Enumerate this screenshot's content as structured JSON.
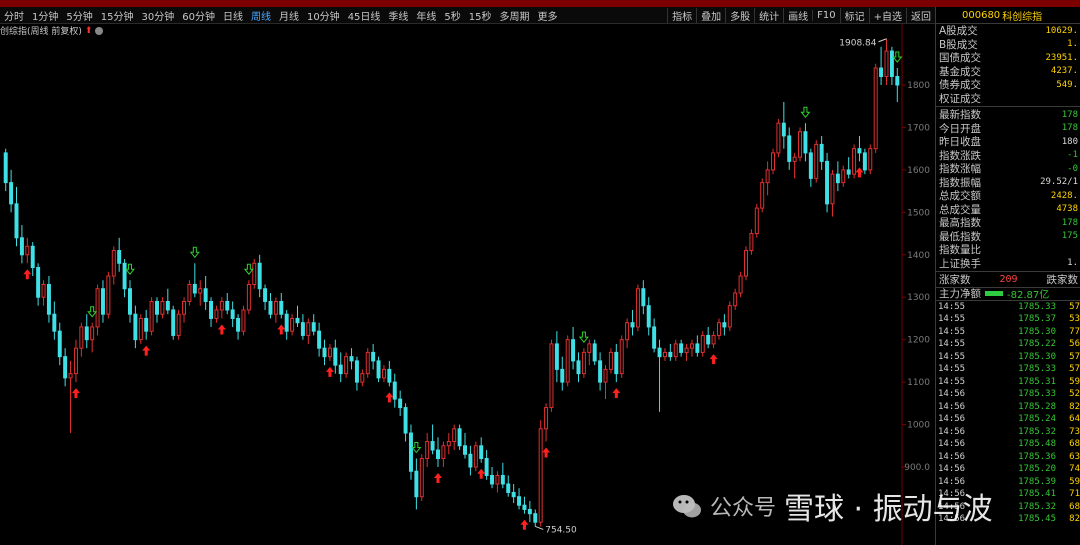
{
  "toolbar": {
    "periods": [
      "分时",
      "1分钟",
      "5分钟",
      "15分钟",
      "30分钟",
      "60分钟",
      "日线",
      "周线",
      "月线",
      "10分钟",
      "45日线",
      "季线",
      "年线",
      "5秒",
      "15秒",
      "多周期",
      "更多"
    ],
    "active_period": "周线",
    "tools": [
      "指标",
      "叠加",
      "多股",
      "统计",
      "画线",
      "F10",
      "标记",
      "+自选",
      "返回"
    ]
  },
  "chart_title": {
    "name": "创综指(周线 前复权)"
  },
  "y_axis": {
    "ticks": [
      "1800",
      "1700",
      "1600",
      "1500",
      "1400",
      "1300",
      "1200",
      "1100",
      "1000",
      "900.0"
    ]
  },
  "annotations": {
    "high_label": "1908.84",
    "low_label": "754.50"
  },
  "chart_data": {
    "type": "candlestick",
    "title": "创综指(周线 前复权)",
    "y_range": [
      754.5,
      1908.84
    ],
    "y_ticks": [
      900,
      1000,
      1100,
      1200,
      1300,
      1400,
      1500,
      1600,
      1700,
      1800
    ],
    "annotations": [
      {
        "label": "1908.84",
        "type": "max"
      },
      {
        "label": "754.50",
        "type": "min"
      }
    ],
    "ohlc": [
      [
        1640,
        1650,
        1550,
        1570
      ],
      [
        1570,
        1600,
        1500,
        1520
      ],
      [
        1520,
        1560,
        1420,
        1440
      ],
      [
        1440,
        1470,
        1380,
        1400
      ],
      [
        1400,
        1440,
        1380,
        1420
      ],
      [
        1420,
        1430,
        1350,
        1370
      ],
      [
        1370,
        1380,
        1280,
        1300
      ],
      [
        1300,
        1340,
        1280,
        1330
      ],
      [
        1330,
        1350,
        1240,
        1260
      ],
      [
        1260,
        1290,
        1200,
        1220
      ],
      [
        1220,
        1240,
        1140,
        1160
      ],
      [
        1160,
        1180,
        1090,
        1110
      ],
      [
        1110,
        1150,
        980,
        1120
      ],
      [
        1120,
        1200,
        1100,
        1180
      ],
      [
        1180,
        1240,
        1160,
        1230
      ],
      [
        1230,
        1260,
        1180,
        1200
      ],
      [
        1200,
        1240,
        1170,
        1230
      ],
      [
        1230,
        1330,
        1210,
        1320
      ],
      [
        1320,
        1340,
        1240,
        1260
      ],
      [
        1260,
        1360,
        1250,
        1350
      ],
      [
        1350,
        1420,
        1330,
        1410
      ],
      [
        1410,
        1440,
        1360,
        1380
      ],
      [
        1380,
        1390,
        1300,
        1320
      ],
      [
        1320,
        1340,
        1240,
        1260
      ],
      [
        1260,
        1280,
        1180,
        1200
      ],
      [
        1200,
        1260,
        1190,
        1250
      ],
      [
        1250,
        1270,
        1200,
        1220
      ],
      [
        1220,
        1300,
        1210,
        1290
      ],
      [
        1290,
        1300,
        1240,
        1260
      ],
      [
        1260,
        1300,
        1250,
        1290
      ],
      [
        1290,
        1320,
        1260,
        1270
      ],
      [
        1270,
        1280,
        1200,
        1210
      ],
      [
        1210,
        1270,
        1200,
        1260
      ],
      [
        1260,
        1300,
        1240,
        1290
      ],
      [
        1290,
        1340,
        1280,
        1330
      ],
      [
        1330,
        1380,
        1300,
        1310
      ],
      [
        1310,
        1340,
        1280,
        1320
      ],
      [
        1320,
        1350,
        1270,
        1290
      ],
      [
        1290,
        1300,
        1230,
        1250
      ],
      [
        1250,
        1280,
        1240,
        1270
      ],
      [
        1270,
        1300,
        1250,
        1290
      ],
      [
        1290,
        1310,
        1260,
        1270
      ],
      [
        1270,
        1290,
        1230,
        1250
      ],
      [
        1250,
        1260,
        1200,
        1220
      ],
      [
        1220,
        1280,
        1210,
        1270
      ],
      [
        1270,
        1340,
        1260,
        1330
      ],
      [
        1330,
        1390,
        1320,
        1380
      ],
      [
        1380,
        1400,
        1300,
        1320
      ],
      [
        1320,
        1330,
        1270,
        1290
      ],
      [
        1290,
        1310,
        1250,
        1260
      ],
      [
        1260,
        1300,
        1240,
        1290
      ],
      [
        1290,
        1310,
        1250,
        1260
      ],
      [
        1260,
        1270,
        1200,
        1220
      ],
      [
        1220,
        1260,
        1210,
        1250
      ],
      [
        1250,
        1280,
        1230,
        1240
      ],
      [
        1240,
        1260,
        1200,
        1210
      ],
      [
        1210,
        1250,
        1190,
        1240
      ],
      [
        1240,
        1260,
        1210,
        1220
      ],
      [
        1220,
        1240,
        1160,
        1180
      ],
      [
        1180,
        1200,
        1140,
        1160
      ],
      [
        1160,
        1190,
        1150,
        1180
      ],
      [
        1180,
        1200,
        1120,
        1140
      ],
      [
        1140,
        1170,
        1100,
        1120
      ],
      [
        1120,
        1170,
        1110,
        1160
      ],
      [
        1160,
        1180,
        1130,
        1150
      ],
      [
        1150,
        1160,
        1080,
        1100
      ],
      [
        1100,
        1130,
        1090,
        1120
      ],
      [
        1120,
        1180,
        1110,
        1170
      ],
      [
        1170,
        1190,
        1130,
        1150
      ],
      [
        1150,
        1160,
        1100,
        1110
      ],
      [
        1110,
        1140,
        1100,
        1130
      ],
      [
        1130,
        1150,
        1090,
        1100
      ],
      [
        1100,
        1120,
        1040,
        1060
      ],
      [
        1060,
        1080,
        1020,
        1040
      ],
      [
        1040,
        1050,
        960,
        980
      ],
      [
        980,
        1000,
        870,
        890
      ],
      [
        890,
        920,
        800,
        830
      ],
      [
        830,
        930,
        820,
        920
      ],
      [
        920,
        980,
        900,
        960
      ],
      [
        960,
        1000,
        930,
        940
      ],
      [
        940,
        970,
        900,
        920
      ],
      [
        920,
        960,
        900,
        950
      ],
      [
        950,
        980,
        930,
        960
      ],
      [
        960,
        1000,
        940,
        990
      ],
      [
        990,
        1000,
        940,
        950
      ],
      [
        950,
        980,
        920,
        930
      ],
      [
        930,
        950,
        880,
        900
      ],
      [
        900,
        960,
        890,
        950
      ],
      [
        950,
        970,
        910,
        920
      ],
      [
        920,
        940,
        870,
        880
      ],
      [
        880,
        900,
        850,
        860
      ],
      [
        860,
        890,
        840,
        880
      ],
      [
        880,
        910,
        850,
        860
      ],
      [
        860,
        880,
        830,
        840
      ],
      [
        840,
        860,
        815,
        830
      ],
      [
        830,
        850,
        800,
        810
      ],
      [
        810,
        830,
        790,
        800
      ],
      [
        800,
        820,
        770,
        790
      ],
      [
        790,
        800,
        760,
        770
      ],
      [
        770,
        1010,
        760,
        990
      ],
      [
        990,
        1050,
        960,
        1040
      ],
      [
        1040,
        1200,
        1030,
        1190
      ],
      [
        1190,
        1220,
        1100,
        1130
      ],
      [
        1130,
        1160,
        1080,
        1100
      ],
      [
        1100,
        1210,
        1090,
        1200
      ],
      [
        1200,
        1230,
        1130,
        1150
      ],
      [
        1150,
        1170,
        1100,
        1120
      ],
      [
        1120,
        1180,
        1110,
        1170
      ],
      [
        1170,
        1200,
        1140,
        1190
      ],
      [
        1190,
        1200,
        1140,
        1150
      ],
      [
        1150,
        1170,
        1080,
        1100
      ],
      [
        1100,
        1140,
        1060,
        1130
      ],
      [
        1130,
        1180,
        1120,
        1170
      ],
      [
        1170,
        1190,
        1100,
        1120
      ],
      [
        1120,
        1210,
        1110,
        1200
      ],
      [
        1200,
        1250,
        1180,
        1240
      ],
      [
        1240,
        1270,
        1210,
        1230
      ],
      [
        1230,
        1330,
        1220,
        1320
      ],
      [
        1320,
        1340,
        1260,
        1280
      ],
      [
        1280,
        1300,
        1210,
        1230
      ],
      [
        1230,
        1250,
        1170,
        1180
      ],
      [
        1180,
        1200,
        1030,
        1160
      ],
      [
        1160,
        1180,
        1150,
        1170
      ],
      [
        1170,
        1190,
        1150,
        1160
      ],
      [
        1160,
        1200,
        1150,
        1190
      ],
      [
        1190,
        1200,
        1160,
        1170
      ],
      [
        1170,
        1190,
        1150,
        1180
      ],
      [
        1180,
        1200,
        1160,
        1190
      ],
      [
        1190,
        1210,
        1160,
        1170
      ],
      [
        1170,
        1220,
        1160,
        1210
      ],
      [
        1210,
        1230,
        1180,
        1190
      ],
      [
        1190,
        1220,
        1180,
        1210
      ],
      [
        1210,
        1250,
        1200,
        1240
      ],
      [
        1240,
        1260,
        1210,
        1230
      ],
      [
        1230,
        1290,
        1220,
        1280
      ],
      [
        1280,
        1320,
        1270,
        1310
      ],
      [
        1310,
        1360,
        1300,
        1350
      ],
      [
        1350,
        1420,
        1340,
        1410
      ],
      [
        1410,
        1460,
        1400,
        1450
      ],
      [
        1450,
        1520,
        1440,
        1510
      ],
      [
        1510,
        1580,
        1500,
        1570
      ],
      [
        1570,
        1620,
        1540,
        1600
      ],
      [
        1600,
        1650,
        1590,
        1640
      ],
      [
        1640,
        1720,
        1630,
        1710
      ],
      [
        1710,
        1760,
        1650,
        1680
      ],
      [
        1680,
        1700,
        1600,
        1620
      ],
      [
        1620,
        1640,
        1580,
        1630
      ],
      [
        1630,
        1700,
        1620,
        1690
      ],
      [
        1690,
        1710,
        1620,
        1640
      ],
      [
        1640,
        1650,
        1560,
        1580
      ],
      [
        1580,
        1670,
        1570,
        1660
      ],
      [
        1660,
        1680,
        1600,
        1620
      ],
      [
        1620,
        1640,
        1500,
        1520
      ],
      [
        1520,
        1600,
        1490,
        1590
      ],
      [
        1590,
        1620,
        1550,
        1570
      ],
      [
        1570,
        1610,
        1560,
        1600
      ],
      [
        1600,
        1630,
        1580,
        1590
      ],
      [
        1590,
        1660,
        1580,
        1650
      ],
      [
        1650,
        1680,
        1620,
        1640
      ],
      [
        1640,
        1650,
        1590,
        1600
      ],
      [
        1600,
        1660,
        1590,
        1650
      ],
      [
        1650,
        1850,
        1640,
        1840
      ],
      [
        1840,
        1890,
        1800,
        1820
      ],
      [
        1820,
        1909,
        1800,
        1880
      ],
      [
        1880,
        1890,
        1800,
        1820
      ],
      [
        1820,
        1840,
        1760,
        1800
      ]
    ],
    "buy_signals": [
      4,
      13,
      26,
      40,
      51,
      60,
      71,
      80,
      88,
      96,
      100,
      113,
      131,
      158
    ],
    "sell_signals": [
      16,
      23,
      35,
      45,
      76,
      107,
      148,
      165
    ]
  },
  "panel": {
    "code": "000680",
    "name": "科创综指",
    "stats1": [
      {
        "label": "A股成交",
        "value": "10629."
      },
      {
        "label": "B股成交",
        "value": "1."
      },
      {
        "label": "国债成交",
        "value": "23951."
      },
      {
        "label": "基金成交",
        "value": "4237."
      },
      {
        "label": "债券成交",
        "value": "549."
      },
      {
        "label": "权证成交",
        "value": ""
      }
    ],
    "stats2": [
      {
        "label": "最新指数",
        "value": "178"
      },
      {
        "label": "今日开盘",
        "value": "178"
      },
      {
        "label": "昨日收盘",
        "value": "180"
      },
      {
        "label": "指数涨跌",
        "value": "-1"
      },
      {
        "label": "指数涨幅",
        "value": "-0"
      },
      {
        "label": "指数振幅",
        "value": "29.52/1"
      },
      {
        "label": "总成交额",
        "value": "2428."
      },
      {
        "label": "总成交量",
        "value": "4738"
      },
      {
        "label": "最高指数",
        "value": "178"
      },
      {
        "label": "最低指数",
        "value": "175"
      },
      {
        "label": "指数量比",
        "value": ""
      },
      {
        "label": "上证换手",
        "value": "1."
      }
    ],
    "breadth": {
      "up_label": "涨家数",
      "up_value": "209",
      "down_label": "跌家数"
    },
    "flow": {
      "label": "主力净额",
      "value": "-82.87亿"
    },
    "ticks": [
      {
        "t": "14:55",
        "p": "1785.33",
        "v": "57"
      },
      {
        "t": "14:55",
        "p": "1785.37",
        "v": "53"
      },
      {
        "t": "14:55",
        "p": "1785.30",
        "v": "77"
      },
      {
        "t": "14:55",
        "p": "1785.22",
        "v": "56"
      },
      {
        "t": "14:55",
        "p": "1785.30",
        "v": "57"
      },
      {
        "t": "14:55",
        "p": "1785.33",
        "v": "57"
      },
      {
        "t": "14:55",
        "p": "1785.31",
        "v": "59"
      },
      {
        "t": "14:56",
        "p": "1785.33",
        "v": "52"
      },
      {
        "t": "14:56",
        "p": "1785.28",
        "v": "82"
      },
      {
        "t": "14:56",
        "p": "1785.24",
        "v": "64"
      },
      {
        "t": "14:56",
        "p": "1785.32",
        "v": "73"
      },
      {
        "t": "14:56",
        "p": "1785.48",
        "v": "68"
      },
      {
        "t": "14:56",
        "p": "1785.36",
        "v": "63"
      },
      {
        "t": "14:56",
        "p": "1785.20",
        "v": "74"
      },
      {
        "t": "14:56",
        "p": "1785.39",
        "v": "59"
      },
      {
        "t": "14:56",
        "p": "1785.41",
        "v": "71"
      },
      {
        "t": "14:56",
        "p": "1785.32",
        "v": "68"
      },
      {
        "t": "14:56",
        "p": "1785.45",
        "v": "82"
      }
    ]
  },
  "watermark": {
    "text1": "公众号",
    "text2": "雪球 · 振动与波"
  },
  "colors": {
    "up": "#e03030",
    "down": "#3fe0e6",
    "axis": "#7a0000"
  }
}
